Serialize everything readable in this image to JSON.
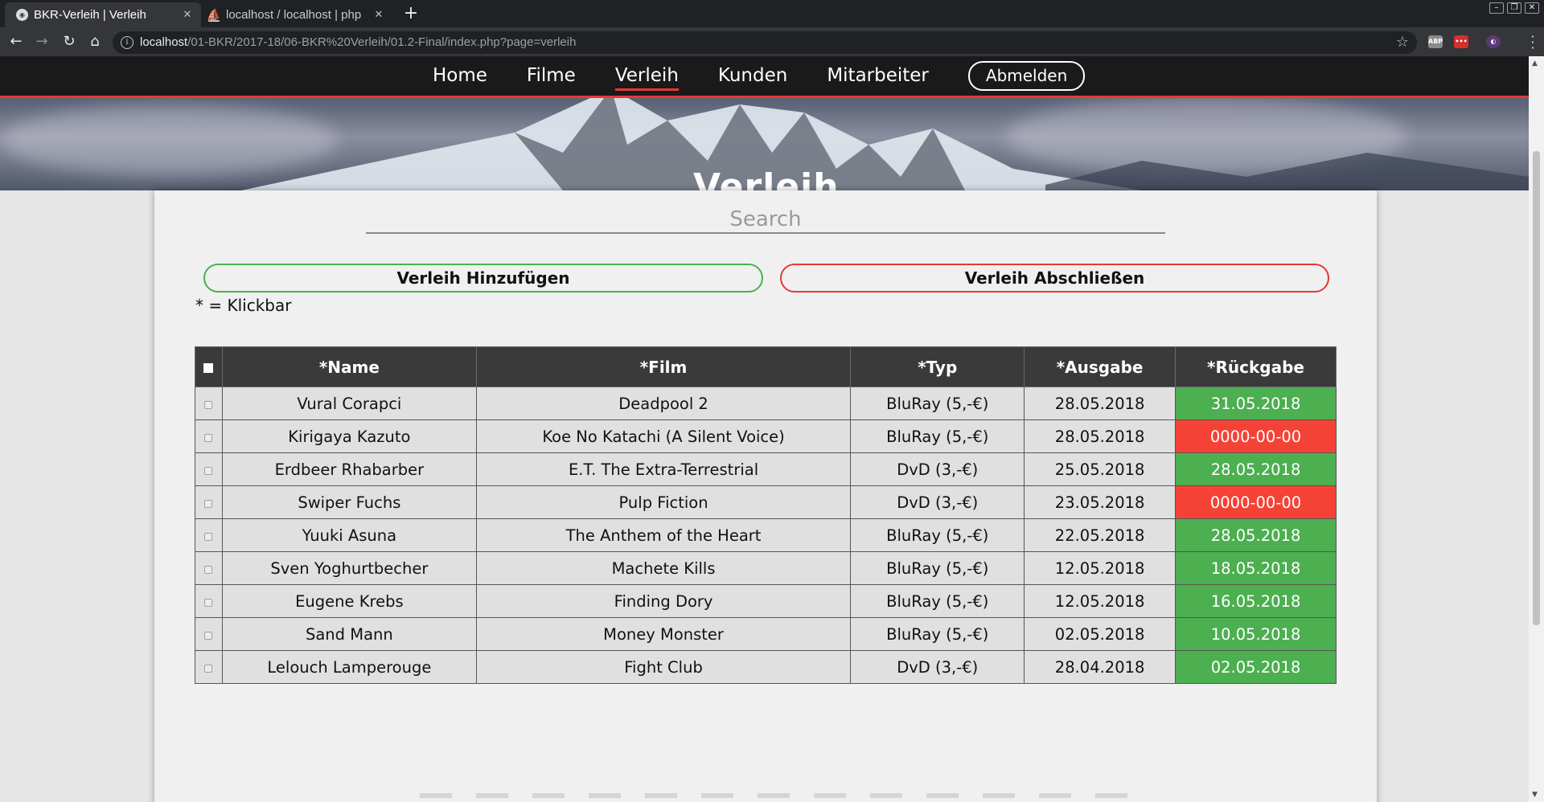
{
  "browser": {
    "tabs": [
      {
        "title": "BKR-Verleih | Verleih",
        "active": true,
        "favicon": "chromium-icon"
      },
      {
        "title": "localhost / localhost | php",
        "active": false,
        "favicon": "phpmyadmin-icon"
      }
    ],
    "new_tab": "+",
    "url_host": "localhost",
    "url_path": "/01-BKR/2017-18/06-BKR%20Verleih/01.2-Final/index.php?page=verleih"
  },
  "nav": {
    "links": [
      "Home",
      "Filme",
      "Verleih",
      "Kunden",
      "Mitarbeiter"
    ],
    "active": "Verleih",
    "logout": "Abmelden",
    "accent": "#e53935"
  },
  "hero": {
    "title": "Verleih"
  },
  "search": {
    "placeholder": "Search"
  },
  "buttons": {
    "add": "Verleih Hinzufügen",
    "close": "Verleih Abschließen"
  },
  "hint": "* = Klickbar",
  "table": {
    "headers": [
      "*Name",
      "*Film",
      "*Typ",
      "*Ausgabe",
      "*Rückgabe"
    ],
    "rows": [
      {
        "name": "Vural Corapci",
        "film": "Deadpool 2",
        "typ": "BluRay (5,-€)",
        "ausgabe": "28.05.2018",
        "rueckgabe": "31.05.2018",
        "status": "returned"
      },
      {
        "name": "Kirigaya Kazuto",
        "film": "Koe No Katachi (A Silent Voice)",
        "typ": "BluRay (5,-€)",
        "ausgabe": "28.05.2018",
        "rueckgabe": "0000-00-00",
        "status": "open"
      },
      {
        "name": "Erdbeer Rhabarber",
        "film": "E.T. The Extra-Terrestrial",
        "typ": "DvD (3,-€)",
        "ausgabe": "25.05.2018",
        "rueckgabe": "28.05.2018",
        "status": "returned"
      },
      {
        "name": "Swiper Fuchs",
        "film": "Pulp Fiction",
        "typ": "DvD (3,-€)",
        "ausgabe": "23.05.2018",
        "rueckgabe": "0000-00-00",
        "status": "open"
      },
      {
        "name": "Yuuki Asuna",
        "film": "The Anthem of the Heart",
        "typ": "BluRay (5,-€)",
        "ausgabe": "22.05.2018",
        "rueckgabe": "28.05.2018",
        "status": "returned"
      },
      {
        "name": "Sven Yoghurtbecher",
        "film": "Machete Kills",
        "typ": "BluRay (5,-€)",
        "ausgabe": "12.05.2018",
        "rueckgabe": "18.05.2018",
        "status": "returned"
      },
      {
        "name": "Eugene Krebs",
        "film": "Finding Dory",
        "typ": "BluRay (5,-€)",
        "ausgabe": "12.05.2018",
        "rueckgabe": "16.05.2018",
        "status": "returned"
      },
      {
        "name": "Sand Mann",
        "film": "Money Monster",
        "typ": "BluRay (5,-€)",
        "ausgabe": "02.05.2018",
        "rueckgabe": "10.05.2018",
        "status": "returned"
      },
      {
        "name": "Lelouch Lamperouge",
        "film": "Fight Club",
        "typ": "DvD (3,-€)",
        "ausgabe": "28.04.2018",
        "rueckgabe": "02.05.2018",
        "status": "returned"
      }
    ]
  },
  "colors": {
    "returned": "#4caf50",
    "open": "#f44336",
    "header": "#3a3a3a"
  }
}
